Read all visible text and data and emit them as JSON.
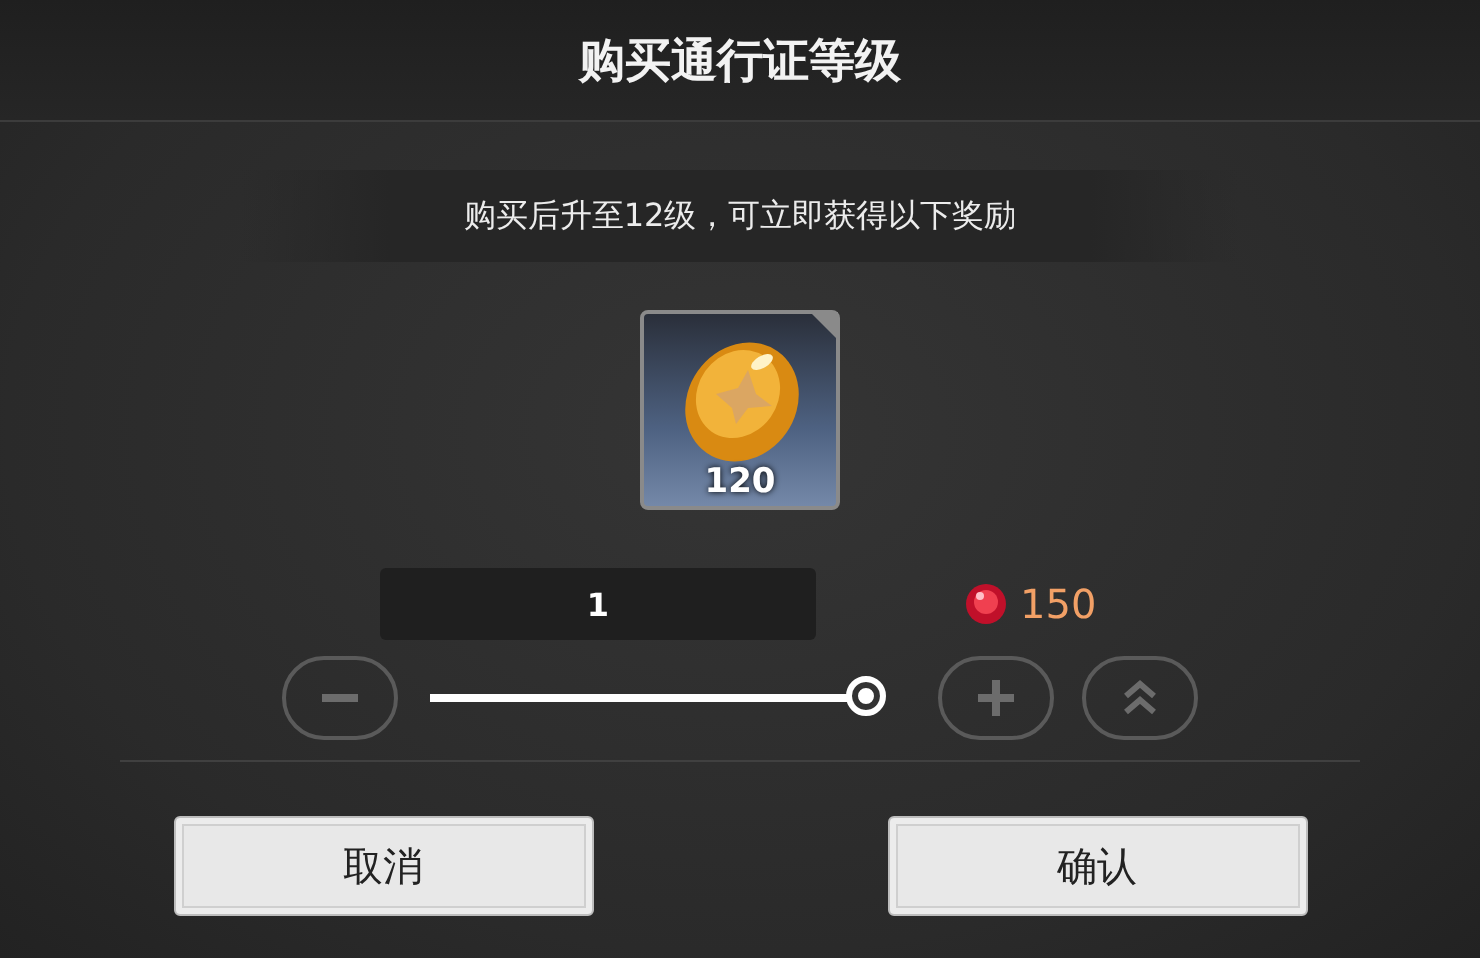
{
  "dialog": {
    "title": "购买通行证等级"
  },
  "message": "购买后升至12级，可立即获得以下奖励",
  "rewards": [
    {
      "count": "120"
    }
  ],
  "quantity": {
    "value": "1",
    "level": 1
  },
  "cost": "150",
  "buttons": [
    {
      "label": "取消"
    },
    {
      "label": "确认"
    }
  ]
}
